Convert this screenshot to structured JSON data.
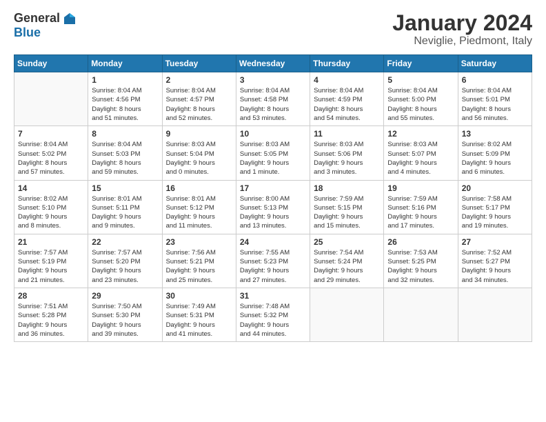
{
  "header": {
    "logo_general": "General",
    "logo_blue": "Blue",
    "title": "January 2024",
    "location": "Neviglie, Piedmont, Italy"
  },
  "weekdays": [
    "Sunday",
    "Monday",
    "Tuesday",
    "Wednesday",
    "Thursday",
    "Friday",
    "Saturday"
  ],
  "weeks": [
    [
      {
        "day": "",
        "info": ""
      },
      {
        "day": "1",
        "info": "Sunrise: 8:04 AM\nSunset: 4:56 PM\nDaylight: 8 hours\nand 51 minutes."
      },
      {
        "day": "2",
        "info": "Sunrise: 8:04 AM\nSunset: 4:57 PM\nDaylight: 8 hours\nand 52 minutes."
      },
      {
        "day": "3",
        "info": "Sunrise: 8:04 AM\nSunset: 4:58 PM\nDaylight: 8 hours\nand 53 minutes."
      },
      {
        "day": "4",
        "info": "Sunrise: 8:04 AM\nSunset: 4:59 PM\nDaylight: 8 hours\nand 54 minutes."
      },
      {
        "day": "5",
        "info": "Sunrise: 8:04 AM\nSunset: 5:00 PM\nDaylight: 8 hours\nand 55 minutes."
      },
      {
        "day": "6",
        "info": "Sunrise: 8:04 AM\nSunset: 5:01 PM\nDaylight: 8 hours\nand 56 minutes."
      }
    ],
    [
      {
        "day": "7",
        "info": "Sunrise: 8:04 AM\nSunset: 5:02 PM\nDaylight: 8 hours\nand 57 minutes."
      },
      {
        "day": "8",
        "info": "Sunrise: 8:04 AM\nSunset: 5:03 PM\nDaylight: 8 hours\nand 59 minutes."
      },
      {
        "day": "9",
        "info": "Sunrise: 8:03 AM\nSunset: 5:04 PM\nDaylight: 9 hours\nand 0 minutes."
      },
      {
        "day": "10",
        "info": "Sunrise: 8:03 AM\nSunset: 5:05 PM\nDaylight: 9 hours\nand 1 minute."
      },
      {
        "day": "11",
        "info": "Sunrise: 8:03 AM\nSunset: 5:06 PM\nDaylight: 9 hours\nand 3 minutes."
      },
      {
        "day": "12",
        "info": "Sunrise: 8:03 AM\nSunset: 5:07 PM\nDaylight: 9 hours\nand 4 minutes."
      },
      {
        "day": "13",
        "info": "Sunrise: 8:02 AM\nSunset: 5:09 PM\nDaylight: 9 hours\nand 6 minutes."
      }
    ],
    [
      {
        "day": "14",
        "info": "Sunrise: 8:02 AM\nSunset: 5:10 PM\nDaylight: 9 hours\nand 8 minutes."
      },
      {
        "day": "15",
        "info": "Sunrise: 8:01 AM\nSunset: 5:11 PM\nDaylight: 9 hours\nand 9 minutes."
      },
      {
        "day": "16",
        "info": "Sunrise: 8:01 AM\nSunset: 5:12 PM\nDaylight: 9 hours\nand 11 minutes."
      },
      {
        "day": "17",
        "info": "Sunrise: 8:00 AM\nSunset: 5:13 PM\nDaylight: 9 hours\nand 13 minutes."
      },
      {
        "day": "18",
        "info": "Sunrise: 7:59 AM\nSunset: 5:15 PM\nDaylight: 9 hours\nand 15 minutes."
      },
      {
        "day": "19",
        "info": "Sunrise: 7:59 AM\nSunset: 5:16 PM\nDaylight: 9 hours\nand 17 minutes."
      },
      {
        "day": "20",
        "info": "Sunrise: 7:58 AM\nSunset: 5:17 PM\nDaylight: 9 hours\nand 19 minutes."
      }
    ],
    [
      {
        "day": "21",
        "info": "Sunrise: 7:57 AM\nSunset: 5:19 PM\nDaylight: 9 hours\nand 21 minutes."
      },
      {
        "day": "22",
        "info": "Sunrise: 7:57 AM\nSunset: 5:20 PM\nDaylight: 9 hours\nand 23 minutes."
      },
      {
        "day": "23",
        "info": "Sunrise: 7:56 AM\nSunset: 5:21 PM\nDaylight: 9 hours\nand 25 minutes."
      },
      {
        "day": "24",
        "info": "Sunrise: 7:55 AM\nSunset: 5:23 PM\nDaylight: 9 hours\nand 27 minutes."
      },
      {
        "day": "25",
        "info": "Sunrise: 7:54 AM\nSunset: 5:24 PM\nDaylight: 9 hours\nand 29 minutes."
      },
      {
        "day": "26",
        "info": "Sunrise: 7:53 AM\nSunset: 5:25 PM\nDaylight: 9 hours\nand 32 minutes."
      },
      {
        "day": "27",
        "info": "Sunrise: 7:52 AM\nSunset: 5:27 PM\nDaylight: 9 hours\nand 34 minutes."
      }
    ],
    [
      {
        "day": "28",
        "info": "Sunrise: 7:51 AM\nSunset: 5:28 PM\nDaylight: 9 hours\nand 36 minutes."
      },
      {
        "day": "29",
        "info": "Sunrise: 7:50 AM\nSunset: 5:30 PM\nDaylight: 9 hours\nand 39 minutes."
      },
      {
        "day": "30",
        "info": "Sunrise: 7:49 AM\nSunset: 5:31 PM\nDaylight: 9 hours\nand 41 minutes."
      },
      {
        "day": "31",
        "info": "Sunrise: 7:48 AM\nSunset: 5:32 PM\nDaylight: 9 hours\nand 44 minutes."
      },
      {
        "day": "",
        "info": ""
      },
      {
        "day": "",
        "info": ""
      },
      {
        "day": "",
        "info": ""
      }
    ]
  ]
}
